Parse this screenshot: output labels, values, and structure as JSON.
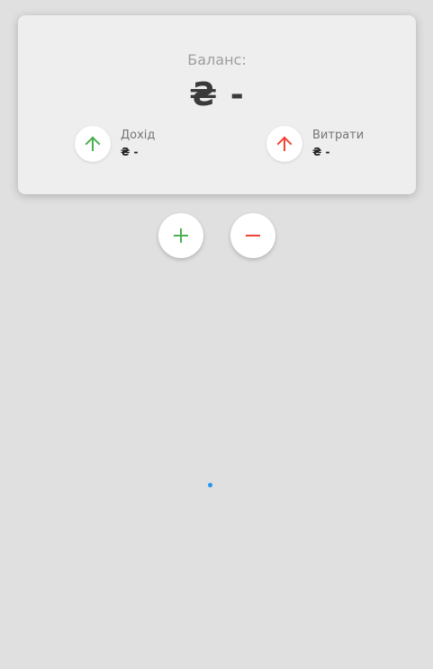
{
  "balance": {
    "label": "Баланс:",
    "value": "₴ -"
  },
  "income": {
    "label": "Дохід",
    "value": "₴ -",
    "icon": "arrow-up-icon",
    "color": "#4caf50"
  },
  "expense": {
    "label": "Витрати",
    "value": "₴ -",
    "icon": "arrow-up-icon",
    "color": "#f44336"
  },
  "actions": {
    "add_icon": "plus-icon",
    "add_color": "#4caf50",
    "remove_icon": "minus-icon",
    "remove_color": "#f44336"
  },
  "loading": {
    "indicator": "spinner",
    "color": "#2196f3"
  }
}
